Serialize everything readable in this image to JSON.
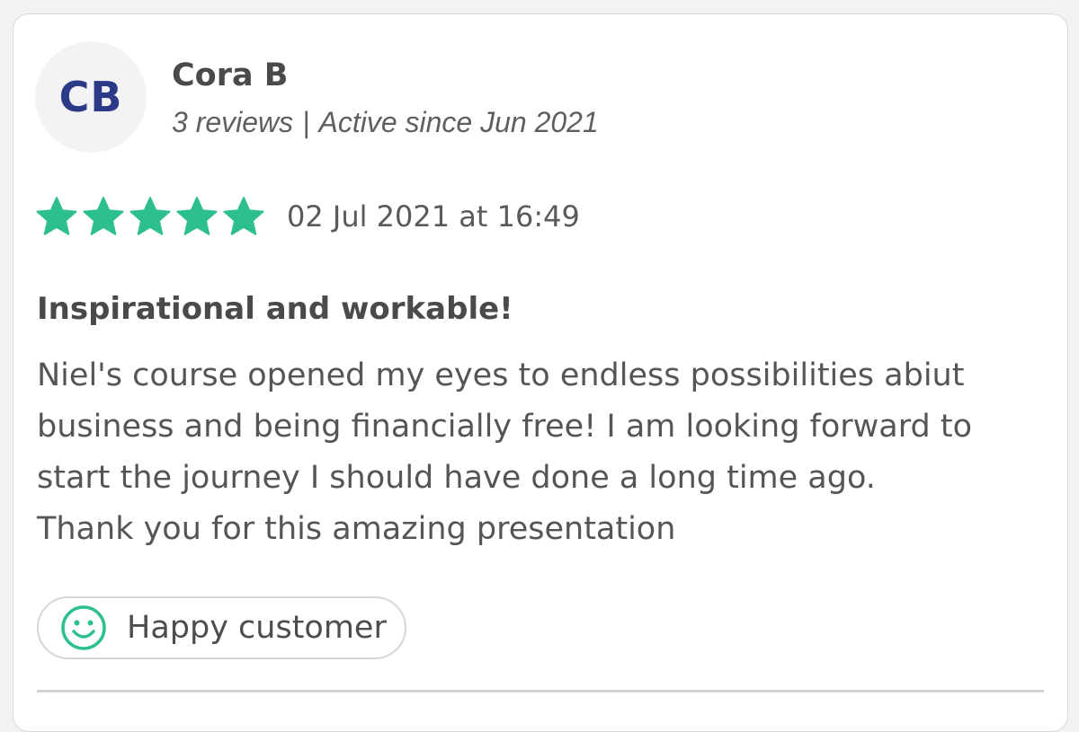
{
  "reviewer": {
    "initials": "CB",
    "name": "Cora B",
    "reviews": "3 reviews",
    "separator": "|",
    "active_since": "Active since Jun 2021"
  },
  "rating": {
    "stars": 5,
    "max_stars": 5,
    "star_color": "#2ebf91"
  },
  "review": {
    "date": "02 Jul 2021 at 16:49",
    "title": "Inspirational and workable!",
    "body_lines": [
      "Niel's course opened my eyes to endless possibilities abiut",
      "business and being financially free! I am looking forward to",
      "start the journey I should have done a long time ago.",
      "Thank you for this amazing presentation"
    ]
  },
  "badge": {
    "icon": "smiley-icon",
    "label": "Happy customer",
    "icon_color": "#2ebf91"
  },
  "colors": {
    "avatar_text": "#2b3a86",
    "accent": "#2ebf91"
  }
}
